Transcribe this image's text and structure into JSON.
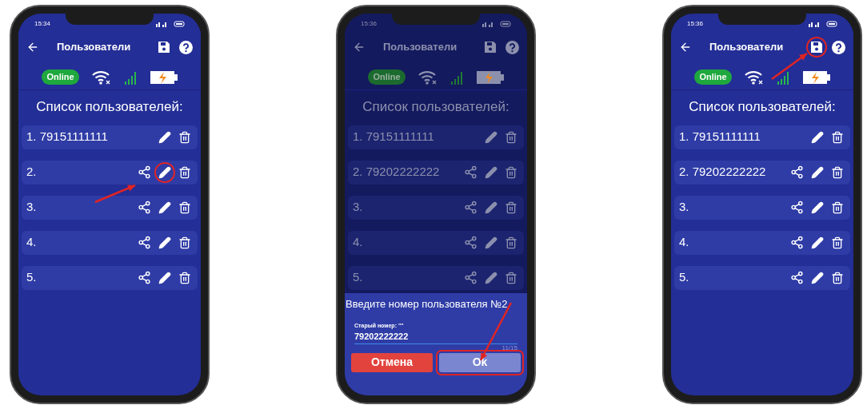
{
  "phones": [
    {
      "time": "15:34",
      "title": "Пользователи",
      "status": "Online",
      "list_title": "Список пользователей:",
      "dimmed": false,
      "save_circled": false,
      "users": [
        {
          "label": "1. 79151111111",
          "share": false,
          "edit_circled": false
        },
        {
          "label": "2.",
          "share": true,
          "edit_circled": true
        },
        {
          "label": "3.",
          "share": true,
          "edit_circled": false
        },
        {
          "label": "4.",
          "share": true,
          "edit_circled": false
        },
        {
          "label": "5.",
          "share": true,
          "edit_circled": false
        }
      ]
    },
    {
      "time": "15:36",
      "title": "Пользователи",
      "status": "Online",
      "list_title": "Список пользователей:",
      "dimmed": true,
      "save_circled": false,
      "users": [
        {
          "label": "1. 79151111111",
          "share": false,
          "edit_circled": false
        },
        {
          "label": "2. 79202222222",
          "share": true,
          "edit_circled": false
        },
        {
          "label": "3.",
          "share": true,
          "edit_circled": false
        },
        {
          "label": "4.",
          "share": true,
          "edit_circled": false
        },
        {
          "label": "5.",
          "share": true,
          "edit_circled": false
        }
      ],
      "dialog": {
        "title": "Введите номер пользователя №2",
        "field_label": "Старый номер: \"\"",
        "value": "79202222222",
        "counter": "11/15",
        "cancel": "Отмена",
        "ok": "Ok",
        "ok_circled": true
      }
    },
    {
      "time": "15:36",
      "title": "Пользователи",
      "status": "Online",
      "list_title": "Список пользователей:",
      "dimmed": false,
      "save_circled": true,
      "users": [
        {
          "label": "1. 79151111111",
          "share": false,
          "edit_circled": false
        },
        {
          "label": "2. 79202222222",
          "share": true,
          "edit_circled": false
        },
        {
          "label": "3.",
          "share": true,
          "edit_circled": false
        },
        {
          "label": "4.",
          "share": true,
          "edit_circled": false
        },
        {
          "label": "5.",
          "share": true,
          "edit_circled": false
        }
      ]
    }
  ]
}
